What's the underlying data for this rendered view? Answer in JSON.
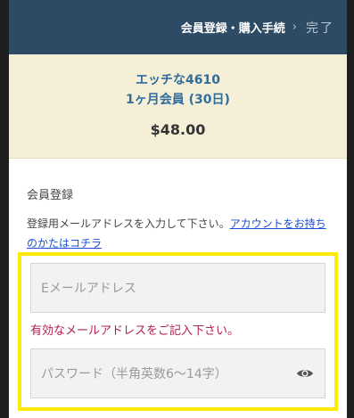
{
  "header": {
    "current_step": "会員登録・購入手続",
    "next_step": "完了",
    "chevron": "›"
  },
  "plan": {
    "name": "エッチな4610",
    "term": "1ヶ月会員 (30日)",
    "price": "$48.00"
  },
  "form": {
    "title": "会員登録",
    "instructions": "登録用メールアドレスを入力して下さい。",
    "login_link": "アカウントをお持ちのかたはコチラ",
    "email_placeholder": "Eメールアドレス",
    "email_error": "有効なメールアドレスをご記入下さい。",
    "password_placeholder": "パスワード（半角英数6～14字）",
    "password_toggle_icon": "eye-icon"
  },
  "colors": {
    "header_bg": "#2e4b66",
    "plan_bg": "#f6efd7",
    "accent_blue": "#2f6d9c",
    "error": "#b3214d",
    "highlight": "#ffeb00"
  }
}
